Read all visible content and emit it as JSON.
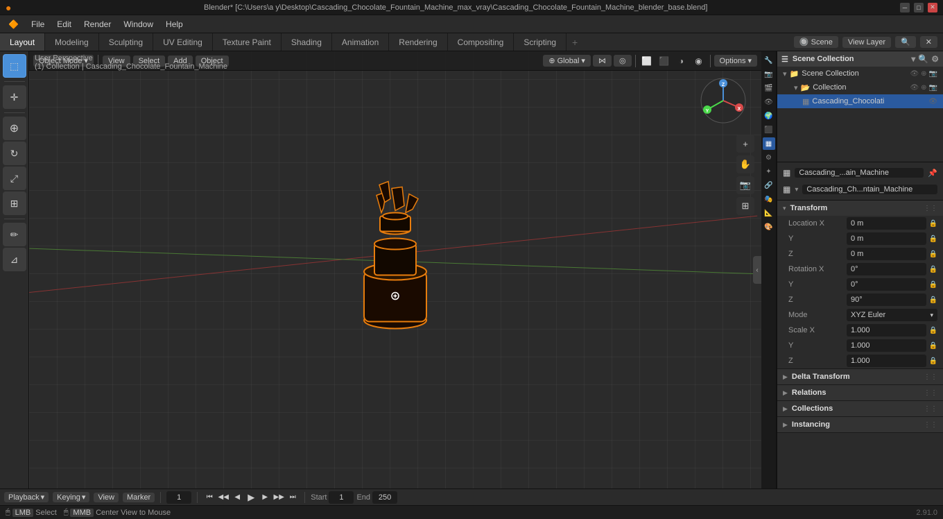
{
  "titlebar": {
    "title": "Blender* [C:\\Users\\a y\\Desktop\\Cascading_Chocolate_Fountain_Machine_max_vray\\Cascading_Chocolate_Fountain_Machine_blender_base.blend]",
    "minimize": "─",
    "maximize": "□",
    "close": "✕"
  },
  "menubar": {
    "items": [
      "Blender",
      "File",
      "Edit",
      "Render",
      "Window",
      "Help"
    ]
  },
  "tabs": {
    "items": [
      "Layout",
      "Modeling",
      "Sculpting",
      "UV Editing",
      "Texture Paint",
      "Shading",
      "Animation",
      "Rendering",
      "Compositing",
      "Scripting"
    ],
    "active": "Layout",
    "add_label": "+",
    "view_layer_label": "View Layer",
    "scene_label": "Scene"
  },
  "toolbar": {
    "tools": [
      {
        "id": "select-box",
        "icon": "⬚",
        "label": "Select Box",
        "active": true
      },
      {
        "id": "cursor",
        "icon": "+",
        "label": "Cursor",
        "active": false
      },
      {
        "id": "move",
        "icon": "✛",
        "label": "Move",
        "active": false
      },
      {
        "id": "rotate",
        "icon": "↻",
        "label": "Rotate",
        "active": false
      },
      {
        "id": "scale",
        "icon": "⤢",
        "label": "Scale",
        "active": false
      },
      {
        "id": "transform",
        "icon": "⊞",
        "label": "Transform",
        "active": false
      },
      {
        "id": "annotate",
        "icon": "✏",
        "label": "Annotate",
        "active": false
      },
      {
        "id": "measure",
        "icon": "⊿",
        "label": "Measure",
        "active": false
      }
    ]
  },
  "viewport": {
    "mode": "Object Mode",
    "view": "View",
    "select": "Select",
    "add": "Add",
    "object": "Object",
    "perspective": "User Perspective",
    "collection": "(1) Collection | Cascading_Chocolate_Fountain_Machine",
    "transform_label": "Global",
    "options_label": "Options"
  },
  "gizmo": {
    "x_label": "X",
    "y_label": "Y",
    "z_label": "Z"
  },
  "outliner": {
    "title": "Scene Collection",
    "items": [
      {
        "id": "scene-collection",
        "name": "Scene Collection",
        "icon": "📁",
        "indent": 0,
        "expanded": true
      },
      {
        "id": "collection",
        "name": "Collection",
        "icon": "📂",
        "indent": 1,
        "expanded": true
      },
      {
        "id": "cascading-chocolate",
        "name": "Cascading_Chocolati",
        "icon": "▦",
        "indent": 2,
        "selected": true
      }
    ]
  },
  "object_info": {
    "name": "Cascading_...ain_Machine",
    "data": "Cascading_Ch...ntain_Machine"
  },
  "properties": {
    "sections": [
      {
        "id": "transform",
        "title": "Transform",
        "expanded": true,
        "fields": [
          {
            "group": "Location",
            "sub": [
              {
                "label": "X",
                "value": "0 m",
                "locked": true
              },
              {
                "label": "Y",
                "value": "0 m",
                "locked": true
              },
              {
                "label": "Z",
                "value": "0 m",
                "locked": true
              }
            ]
          },
          {
            "group": "Rotation",
            "sub": [
              {
                "label": "X",
                "value": "0°",
                "locked": true
              },
              {
                "label": "Y",
                "value": "0°",
                "locked": true
              },
              {
                "label": "Z",
                "value": "90°",
                "locked": true
              }
            ]
          },
          {
            "group": "Mode",
            "value": "XYZ Euler"
          },
          {
            "group": "Scale",
            "sub": [
              {
                "label": "X",
                "value": "1.000",
                "locked": true
              },
              {
                "label": "Y",
                "value": "1.000",
                "locked": true
              },
              {
                "label": "Z",
                "value": "1.000",
                "locked": true
              }
            ]
          }
        ]
      },
      {
        "id": "delta-transform",
        "title": "Delta Transform",
        "expanded": false
      },
      {
        "id": "relations",
        "title": "Relations",
        "expanded": false
      },
      {
        "id": "collections",
        "title": "Collections",
        "expanded": false
      },
      {
        "id": "instancing",
        "title": "Instancing",
        "expanded": false
      }
    ]
  },
  "timeline": {
    "playback_label": "Playback",
    "keying_label": "Keying",
    "view_label": "View",
    "marker_label": "Marker",
    "frame_current": "1",
    "start_label": "Start",
    "start_value": "1",
    "end_label": "End",
    "end_value": "250",
    "transport": {
      "jump_start": "⏮",
      "prev_keyframe": "◀◀",
      "prev_frame": "◀",
      "play": "▶",
      "next_frame": "▶",
      "next_keyframe": "▶▶",
      "jump_end": "⏭"
    }
  },
  "statusbar": {
    "select_key": "LMB",
    "select_label": "Select",
    "cursor_key": "MMB",
    "cursor_label": "Center View to Mouse",
    "version": "2.91.0"
  },
  "prop_icons": [
    {
      "icon": "🔧",
      "label": "scene-properties",
      "active": false
    },
    {
      "icon": "📷",
      "label": "render-properties",
      "active": false
    },
    {
      "icon": "🎬",
      "label": "output-properties",
      "active": false
    },
    {
      "icon": "👁",
      "label": "view-layer-properties",
      "active": false
    },
    {
      "icon": "🌍",
      "label": "scene-properties-2",
      "active": false
    },
    {
      "icon": "⬛",
      "label": "world-properties",
      "active": false
    },
    {
      "icon": "▦",
      "label": "object-properties",
      "active": true
    },
    {
      "icon": "⚙",
      "label": "modifier-properties",
      "active": false
    },
    {
      "icon": "✦",
      "label": "particles-properties",
      "active": false
    },
    {
      "icon": "🔗",
      "label": "physics-properties",
      "active": false
    },
    {
      "icon": "🎭",
      "label": "constraints-properties",
      "active": false
    },
    {
      "icon": "📐",
      "label": "data-properties",
      "active": false
    },
    {
      "icon": "🎨",
      "label": "material-properties",
      "active": false
    }
  ]
}
